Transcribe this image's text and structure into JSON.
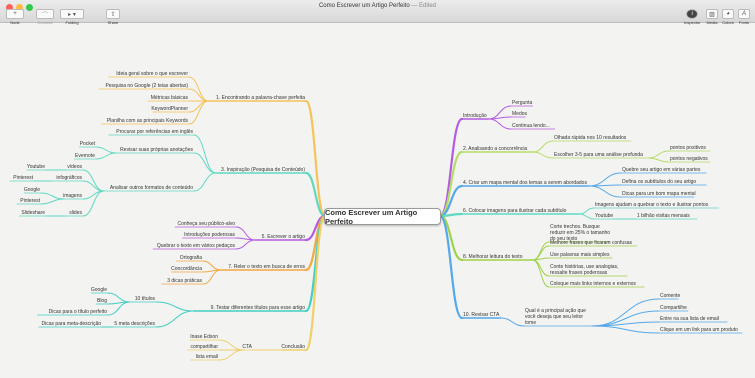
{
  "window": {
    "title": "Como Escrever um Artigo Perfeito",
    "edited": "— Edited"
  },
  "toolbar": {
    "node": "Node",
    "connect": "Connect",
    "folding": "Folding",
    "share": "Share",
    "inspector": "Inspector",
    "media": "Media",
    "colors": "Colors",
    "fonts": "Fonts"
  },
  "map": {
    "central": "Como Escrever um Artigo Perfeito",
    "labels": {
      "b1": "1. Encontrando a palavra-chave perfeita",
      "b1_1": "Ideia geral sobre o que escrever",
      "b1_2": "Pesquisa no Google (2 teias abertas)",
      "b1_3": "Métricas básicas",
      "b1_4": "KeywordPlanner",
      "b1_5": "Planilha com as principais Keywords",
      "b3": "3. Inspiração (Pesquisa de Conteúdo)",
      "b3_1": "Procurar por referências em inglês",
      "b3_2": "Revisar suas próprias anotações",
      "b3_2a": "Pocket",
      "b3_2b": "Evernote",
      "b3_3": "Analisar outros formatos de conteúdo",
      "b3_3a": "vídeos",
      "b3_3a1": "Youtube",
      "b3_3b": "infográficos",
      "b3_3b1": "Pinterest",
      "b3_3c": "imagens",
      "b3_3c1": "Google",
      "b3_3c2": "Pinterest",
      "b3_3d": "slides",
      "b3_3d1": "Slideshare",
      "b5": "5. Escrever o artigo",
      "b5_1": "Conheça seu público-alvo",
      "b5_2": "Introduções poderosas",
      "b5_3": "Quebrar o texto em vários pedaços",
      "b7": "7. Reler o texto em busca de erros",
      "b7_1": "Ortografia",
      "b7_2": "Concordância",
      "b7_3": "3 dicas práticas",
      "b9": "9. Testar diferentes títulos para esse artigo",
      "b9_1": "10 títulos",
      "b9_1a": "Google",
      "b9_1b": "Blog",
      "b9_1c": "Dicas para o título perfeito",
      "b9_2": "5 meta descrições",
      "b9_2a": "Dicas para meta-descrição",
      "bc": "Conclusão",
      "bc_1": "CTA",
      "bc_1a": "Inase Edson",
      "bc_1b": "compartilhar",
      "bc_1c": "lista email",
      "intro": "Introdução",
      "intro_1": "Pergunta",
      "intro_2": "Medos",
      "intro_3": "Continua lendo...",
      "b2": "2. Analisando a concorrência",
      "b2_1": "Olhada rápida nos 10 resultados",
      "b2_2": "Escolher 3-5 para uma análise profunda",
      "b2_2a": "pontos positivos",
      "b2_2b": "pontos negativos",
      "b4": "4. Criar um mapa mental dos temas a serem abordados",
      "b4_1": "Quebre seu artigo em várias partes",
      "b4_2": "Defina os subtítulos do seu artigo",
      "b4_3": "Dicas para um bom mapa mental",
      "b6": "6. Colocar imagens para ilustrar cada subtítulo",
      "b6_1": "Imagens ajudam a quebrar o texto e ilustrar pontos",
      "b6_2": "Youtube",
      "b6_2a": "1 bilhão visitas mensais",
      "b8": "8. Melhorar leitura do texto",
      "b8_1": "Corte trechos. Busque reduzir em 25% o tamanho do seu texto",
      "b8_2": "Melhore frases que ficaram confusas",
      "b8_3": "Use palavras mais simples",
      "b8_4": "Conte histórias, use analogias, ressalte frases poderosas",
      "b8_5": "Coloque mais links internos e externos",
      "b10": "10. Revisar CTA",
      "b10_1": "Qual é a principal ação que você deseja que seu leitor tome",
      "b10_1a": "Comente",
      "b10_1b": "Compartilhe",
      "b10_1c": "Entre na sua lista de email",
      "b10_1d": "Clique em um link para um produto"
    }
  },
  "colors": {
    "yellow": "#f5c35a",
    "cyan": "#5fd9c2",
    "purple": "#b55be0",
    "orange": "#f3a842",
    "teal": "#43cfc4",
    "green": "#9fd24a",
    "blue": "#55a8ea",
    "lightgreen": "#b4dd66",
    "conclusion": "#f2cf6a"
  }
}
